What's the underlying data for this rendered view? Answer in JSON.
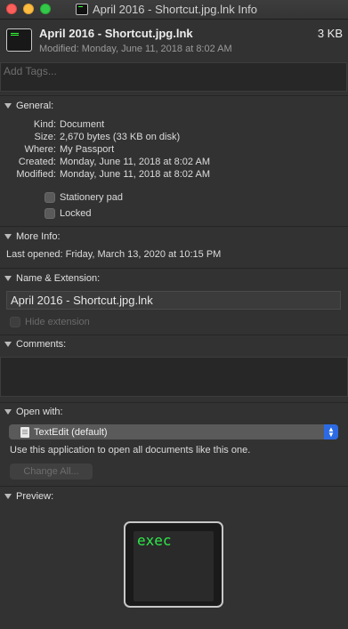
{
  "window": {
    "title": "April 2016 - Shortcut.jpg.lnk Info",
    "traffic_lights": [
      "close",
      "minimize",
      "zoom"
    ]
  },
  "header": {
    "file_name": "April 2016 - Shortcut.jpg.lnk",
    "file_size": "3 KB",
    "modified": "Modified: Monday, June 11, 2018 at 8:02 AM",
    "icon": "terminal-document-icon"
  },
  "tags": {
    "placeholder": "Add Tags..."
  },
  "general": {
    "heading": "General:",
    "fields": [
      {
        "key": "Kind:",
        "value": "Document"
      },
      {
        "key": "Size:",
        "value": "2,670 bytes (33 KB on disk)"
      },
      {
        "key": "Where:",
        "value": "My Passport"
      },
      {
        "key": "Created:",
        "value": "Monday, June 11, 2018 at 8:02 AM"
      },
      {
        "key": "Modified:",
        "value": "Monday, June 11, 2018 at 8:02 AM"
      }
    ],
    "stationery_label": "Stationery pad",
    "stationery_checked": false,
    "locked_label": "Locked",
    "locked_checked": false
  },
  "more_info": {
    "heading": "More Info:",
    "last_opened": "Last opened: Friday, March 13, 2020 at 10:15 PM"
  },
  "name_extension": {
    "heading": "Name & Extension:",
    "name_value": "April 2016 - Shortcut.jpg.lnk",
    "hide_extension_label": "Hide extension",
    "hide_extension_checked": false
  },
  "comments": {
    "heading": "Comments:"
  },
  "open_with": {
    "heading": "Open with:",
    "selected_app": "TextEdit (default)",
    "help_text": "Use this application to open all documents like this one.",
    "change_all_label": "Change All..."
  },
  "preview": {
    "heading": "Preview:",
    "text": "exec"
  },
  "colors": {
    "background": "#323232",
    "accent": "#2b6ae3",
    "terminal_green": "#2ee84a"
  }
}
